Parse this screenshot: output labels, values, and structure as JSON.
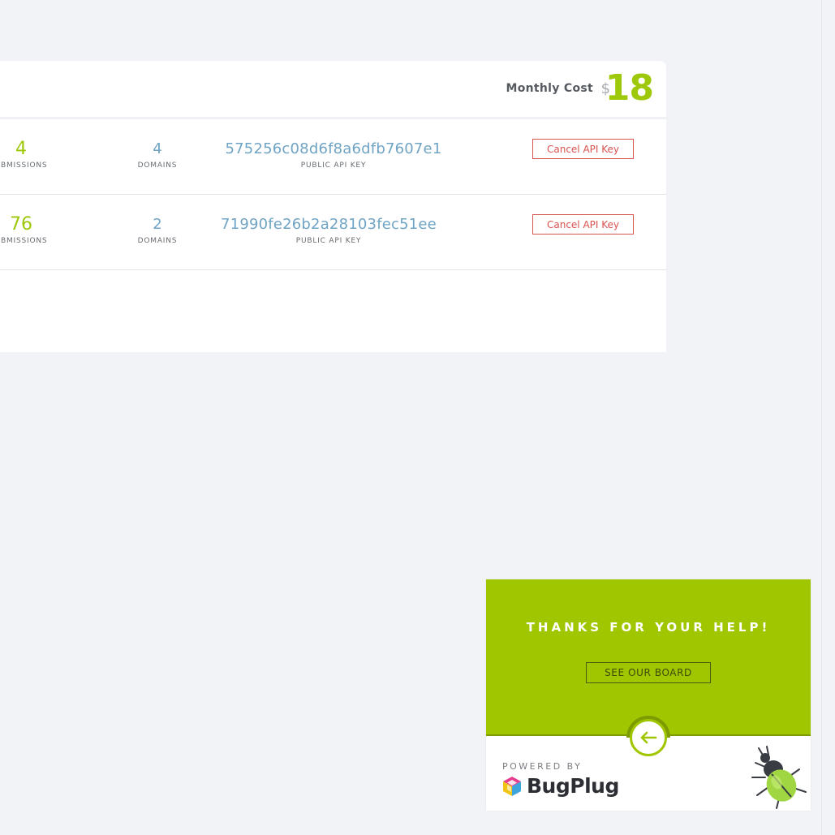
{
  "header": {
    "cost_label": "Monthly Cost",
    "currency": "$",
    "cost_value": "18"
  },
  "rows": [
    {
      "submissions": "4",
      "submissions_label": "UBMISSIONS",
      "domains": "4",
      "domains_label": "DOMAINS",
      "api_key": "575256c08d6f8a6dfb7607e1",
      "api_key_label": "PUBLIC API KEY",
      "cancel_label": "Cancel API Key"
    },
    {
      "submissions": "76",
      "submissions_label": "UBMISSIONS",
      "domains": "2",
      "domains_label": "DOMAINS",
      "api_key": "71990fe26b2a28103fec51ee",
      "api_key_label": "PUBLIC API KEY",
      "cancel_label": "Cancel API Key"
    }
  ],
  "bugplug": {
    "thanks": "THANKS FOR YOUR HELP!",
    "board_button": "SEE OUR BOARD",
    "powered_by": "POWERED BY",
    "brand": "BugPlug",
    "icons": [
      "arrow-left-icon",
      "bugplug-logo-icon",
      "beetle-icon"
    ]
  },
  "colors": {
    "accent_green": "#9ec80a",
    "key_blue": "#6fa4c4",
    "danger_red": "#d9534f",
    "widget_green": "#a0c600"
  }
}
